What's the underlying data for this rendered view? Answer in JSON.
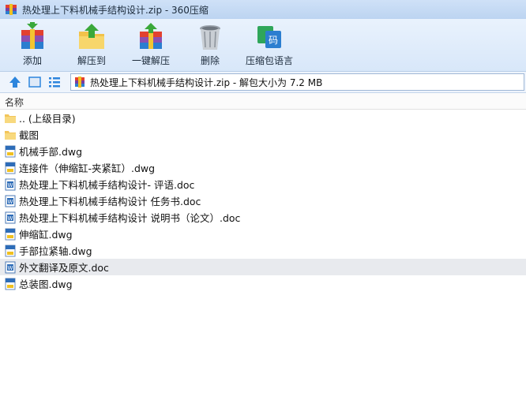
{
  "window": {
    "title": "热处理上下料机械手结构设计.zip - 360压缩"
  },
  "toolbar": {
    "buttons": [
      {
        "label": "添加",
        "icon": "add-archive-icon"
      },
      {
        "label": "解压到",
        "icon": "extract-to-icon"
      },
      {
        "label": "一键解压",
        "icon": "one-click-extract-icon"
      },
      {
        "label": "删除",
        "icon": "trash-icon"
      },
      {
        "label": "压缩包语言",
        "icon": "archive-language-icon"
      }
    ]
  },
  "address": {
    "text": "热处理上下料机械手结构设计.zip - 解包大小为 7.2 MB"
  },
  "list": {
    "column_name": "名称",
    "items": [
      {
        "name": ".. (上级目录)",
        "type": "folder"
      },
      {
        "name": "截图",
        "type": "folder"
      },
      {
        "name": "机械手部.dwg",
        "type": "dwg"
      },
      {
        "name": "连接件（伸缩缸-夹紧缸）.dwg",
        "type": "dwg"
      },
      {
        "name": "热处理上下料机械手结构设计- 评语.doc",
        "type": "doc"
      },
      {
        "name": "热处理上下料机械手结构设计 任务书.doc",
        "type": "doc"
      },
      {
        "name": "热处理上下料机械手结构设计 说明书（论文）.doc",
        "type": "doc"
      },
      {
        "name": "伸缩缸.dwg",
        "type": "dwg"
      },
      {
        "name": "手部拉紧轴.dwg",
        "type": "dwg"
      },
      {
        "name": "外文翻译及原文.doc",
        "type": "doc",
        "selected": true
      },
      {
        "name": "总装图.dwg",
        "type": "dwg"
      }
    ]
  }
}
